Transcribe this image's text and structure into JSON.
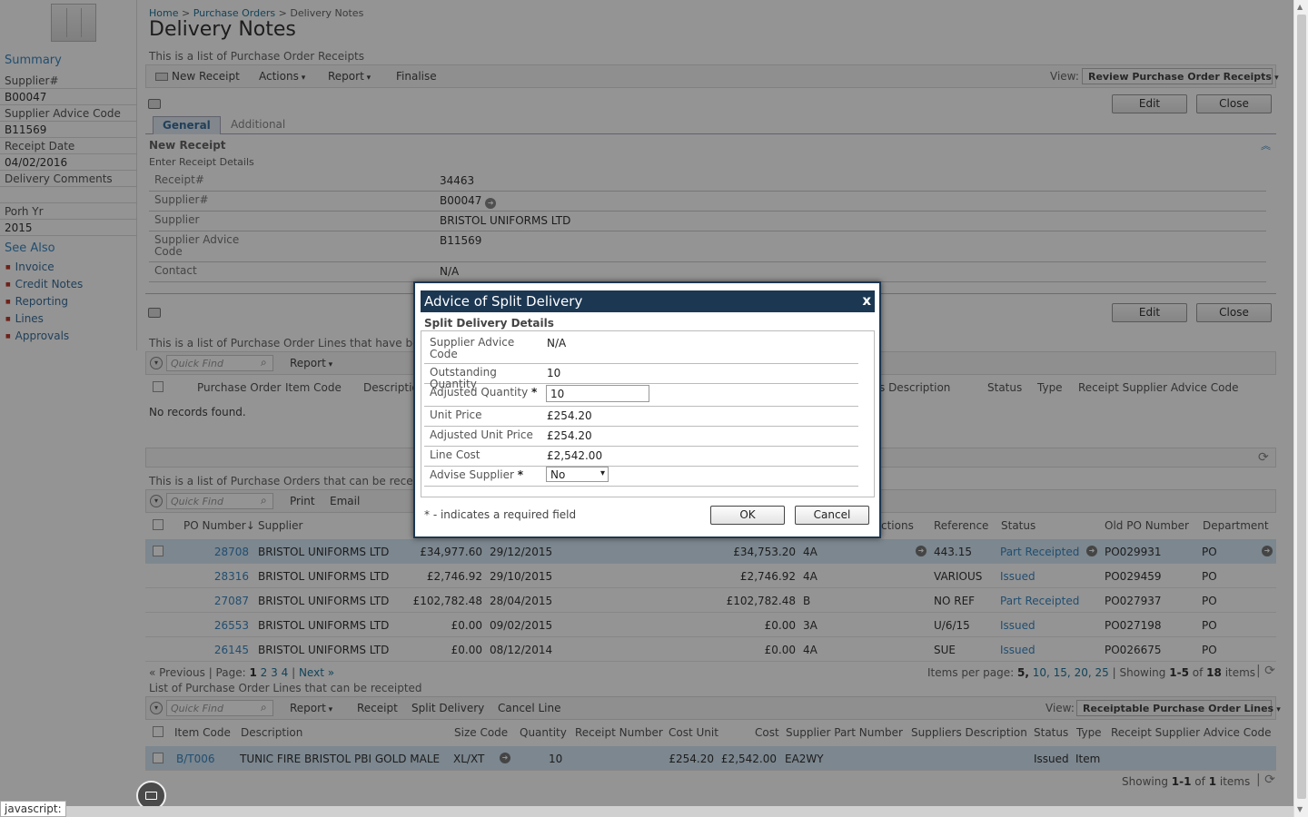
{
  "breadcrumb": {
    "home": "Home",
    "sep1": ">",
    "purchase_orders": "Purchase Orders",
    "sep2": ">",
    "current": "Delivery Notes"
  },
  "page": {
    "title": "Delivery Notes",
    "description": "This is a list of Purchase Order Receipts"
  },
  "sidebar": {
    "summary": "Summary",
    "fields": [
      {
        "label": "Supplier#",
        "value": "B00047"
      },
      {
        "label": "Supplier Advice Code",
        "value": "B11569"
      },
      {
        "label": "Receipt Date",
        "value": "04/02/2016"
      },
      {
        "label": "Delivery Comments",
        "value": ""
      },
      {
        "label": "Porh Yr",
        "value": "2015"
      }
    ],
    "see_also": "See Also",
    "links": [
      "Invoice",
      "Credit Notes",
      "Reporting",
      "Lines",
      "Approvals"
    ]
  },
  "toolbar": {
    "new_receipt": "New Receipt",
    "actions": "Actions",
    "report": "Report",
    "finalise": "Finalise",
    "view_label": "View:",
    "view_value": "Review Purchase Order Receipts"
  },
  "buttons": {
    "edit": "Edit",
    "close": "Close"
  },
  "tabs": [
    "General",
    "Additional"
  ],
  "receipt": {
    "section_title": "New Receipt",
    "section_sub": "Enter Receipt Details",
    "rows": [
      {
        "label": "Receipt#",
        "value": "34463"
      },
      {
        "label": "Supplier#",
        "value": "B00047"
      },
      {
        "label": "Supplier",
        "value": "BRISTOL UNIFORMS LTD"
      },
      {
        "label": "Supplier Advice Code",
        "value": "B11569"
      },
      {
        "label": "Contact",
        "value": "N/A"
      }
    ]
  },
  "lines_grid": {
    "description": "This is a list of Purchase Order Lines that have bee",
    "quick_find": "Quick Find",
    "report": "Report",
    "headers": [
      "Purchase Order",
      "Item Code",
      "Descriptio",
      "s Description",
      "Status",
      "Type",
      "Receipt Supplier Advice Code"
    ],
    "empty": "No records found."
  },
  "po_grid": {
    "description": "This is a list of Purchase Orders that can be receipt",
    "quick_find": "Quick Find",
    "print": "Print",
    "email": "Email",
    "headers": {
      "po_number": "PO Number",
      "supplier": "Supplier",
      "actions": "ctions",
      "reference": "Reference",
      "status": "Status",
      "old_po": "Old PO Number",
      "department": "Department"
    },
    "rows": [
      {
        "po": "28708",
        "supplier": "BRISTOL UNIFORMS LTD",
        "value": "£34,977.60",
        "date": "29/12/2015",
        "value2": "£34,753.20",
        "code": "4A",
        "reference": "443.15",
        "status": "Part Receipted",
        "old_po": "PO029931",
        "dept": "PO"
      },
      {
        "po": "28316",
        "supplier": "BRISTOL UNIFORMS LTD",
        "value": "£2,746.92",
        "date": "29/10/2015",
        "value2": "£2,746.92",
        "code": "4A",
        "reference": "VARIOUS",
        "status": "Issued",
        "old_po": "PO029459",
        "dept": "PO"
      },
      {
        "po": "27087",
        "supplier": "BRISTOL UNIFORMS LTD",
        "value": "£102,782.48",
        "date": "28/04/2015",
        "value2": "£102,782.48",
        "code": "B",
        "reference": "NO REF",
        "status": "Part Receipted",
        "old_po": "PO027937",
        "dept": "PO"
      },
      {
        "po": "26553",
        "supplier": "BRISTOL UNIFORMS LTD",
        "value": "£0.00",
        "date": "09/02/2015",
        "value2": "£0.00",
        "code": "3A",
        "reference": "U/6/15",
        "status": "Issued",
        "old_po": "PO027198",
        "dept": "PO"
      },
      {
        "po": "26145",
        "supplier": "BRISTOL UNIFORMS LTD",
        "value": "£0.00",
        "date": "08/12/2014",
        "value2": "£0.00",
        "code": "4A",
        "reference": "SUE",
        "status": "Issued",
        "old_po": "PO026675",
        "dept": "PO"
      }
    ],
    "pager": {
      "previous": "« Previous",
      "page_label": "| Page:",
      "pages": [
        "1",
        "2",
        "3",
        "4"
      ],
      "sep": "|",
      "next": "Next »",
      "items_per_page": "Items per page:",
      "sizes": [
        "5,",
        "10,",
        "15,",
        "20,",
        "25"
      ],
      "showing": "| Showing",
      "range": "1-5",
      "of": "of",
      "total": "18",
      "items": "items"
    }
  },
  "receipt_lines": {
    "description": "List of Purchase Order Lines that can be receipted",
    "quick_find": "Quick Find",
    "report": "Report",
    "receipt": "Receipt",
    "split_delivery": "Split Delivery",
    "cancel_line": "Cancel Line",
    "view_label": "View:",
    "view_value": "Receiptable Purchase Order Lines",
    "headers": [
      "Item Code",
      "Description",
      "Size Code",
      "Quantity",
      "Receipt Number",
      "Cost Unit",
      "Cost",
      "Supplier Part Number",
      "Suppliers Description",
      "Status",
      "Type",
      "Receipt Supplier Advice Code"
    ],
    "row": {
      "item_code": "B/T006",
      "description": "TUNIC FIRE BRISTOL PBI GOLD MALE",
      "size": "XL/XT",
      "quantity": "10",
      "cost_unit": "£254.20",
      "cost": "£2,542.00",
      "part": "EA2WY",
      "status": "Issued",
      "type": "Item"
    },
    "showing": "Showing",
    "range": "1-1",
    "of": "of",
    "total": "1",
    "items": "items"
  },
  "dialog": {
    "title": "Advice of Split Delivery",
    "subtitle": "Split Delivery Details",
    "rows": [
      {
        "label": "Supplier Advice Code",
        "value": "N/A"
      },
      {
        "label": "Outstanding Quantity",
        "value": "10"
      },
      {
        "label": "Adjusted Quantity",
        "required": "*",
        "value": "10"
      },
      {
        "label": "Unit Price",
        "value": "£254.20"
      },
      {
        "label": "Adjusted Unit Price",
        "value": "£254.20"
      },
      {
        "label": "Line Cost",
        "value": "£2,542.00"
      },
      {
        "label": "Advise Supplier",
        "required": "*",
        "value": "No"
      }
    ],
    "note": "* - indicates a required field",
    "ok": "OK",
    "cancel": "Cancel",
    "close_glyph": "x"
  },
  "status_bar": "javascript:"
}
